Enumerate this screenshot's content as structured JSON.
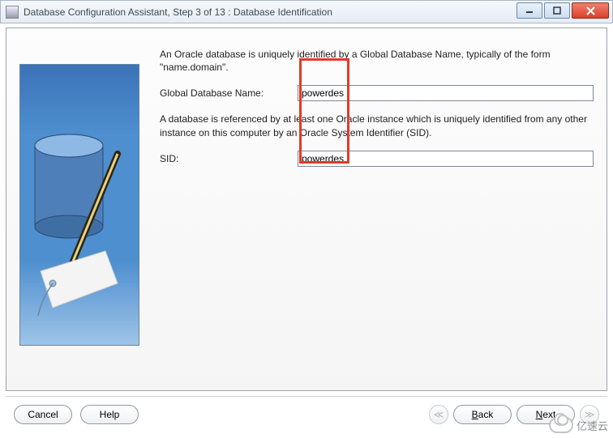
{
  "window": {
    "title": "Database Configuration Assistant, Step 3 of 13 : Database Identification"
  },
  "content": {
    "intro": "An Oracle database is uniquely identified by a Global Database Name, typically of the form \"name.domain\".",
    "gdn_label": "Global Database Name:",
    "gdn_value": "powerdes",
    "sid_intro": "A database is referenced by at least one Oracle instance which is uniquely identified from any other instance on this computer by an Oracle System Identifier (SID).",
    "sid_label": "SID:",
    "sid_value": "powerdes"
  },
  "buttons": {
    "cancel": "Cancel",
    "help": "Help",
    "back_prefix": "B",
    "back_rest": "ack",
    "next_prefix": "N",
    "next_rest": "ext"
  },
  "watermark": "亿速云"
}
